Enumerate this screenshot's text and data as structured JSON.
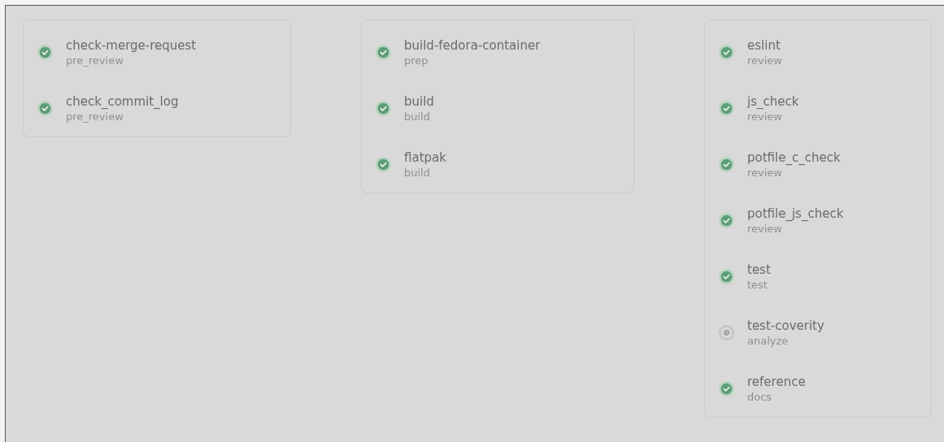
{
  "stages": [
    {
      "jobs": [
        {
          "name": "check-merge-request",
          "stage": "pre_review",
          "kind": "success"
        },
        {
          "name": "check_commit_log",
          "stage": "pre_review",
          "kind": "success"
        }
      ]
    },
    {
      "jobs": [
        {
          "name": "build-fedora-container",
          "stage": "prep",
          "kind": "success"
        },
        {
          "name": "build",
          "stage": "build",
          "kind": "success"
        },
        {
          "name": "flatpak",
          "stage": "build",
          "kind": "success"
        }
      ]
    },
    {
      "jobs": [
        {
          "name": "eslint",
          "stage": "review",
          "kind": "success"
        },
        {
          "name": "js_check",
          "stage": "review",
          "kind": "success"
        },
        {
          "name": "potfile_c_check",
          "stage": "review",
          "kind": "success"
        },
        {
          "name": "potfile_js_check",
          "stage": "review",
          "kind": "success"
        },
        {
          "name": "test",
          "stage": "test",
          "kind": "success"
        },
        {
          "name": "test-coverity",
          "stage": "analyze",
          "kind": "manual"
        },
        {
          "name": "reference",
          "stage": "docs",
          "kind": "success"
        }
      ]
    }
  ]
}
